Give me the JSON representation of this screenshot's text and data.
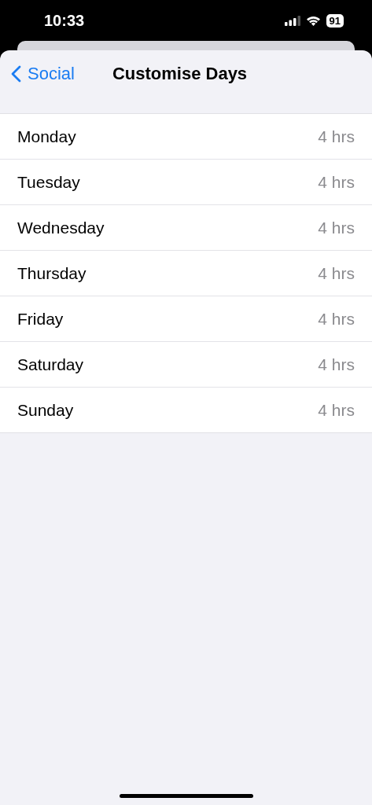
{
  "status_bar": {
    "time": "10:33",
    "battery": "91"
  },
  "nav": {
    "back": "Social",
    "title": "Customise Days"
  },
  "days": [
    {
      "name": "Monday",
      "value": "4 hrs"
    },
    {
      "name": "Tuesday",
      "value": "4 hrs"
    },
    {
      "name": "Wednesday",
      "value": "4 hrs"
    },
    {
      "name": "Thursday",
      "value": "4 hrs"
    },
    {
      "name": "Friday",
      "value": "4 hrs"
    },
    {
      "name": "Saturday",
      "value": "4 hrs"
    },
    {
      "name": "Sunday",
      "value": "4 hrs"
    }
  ]
}
